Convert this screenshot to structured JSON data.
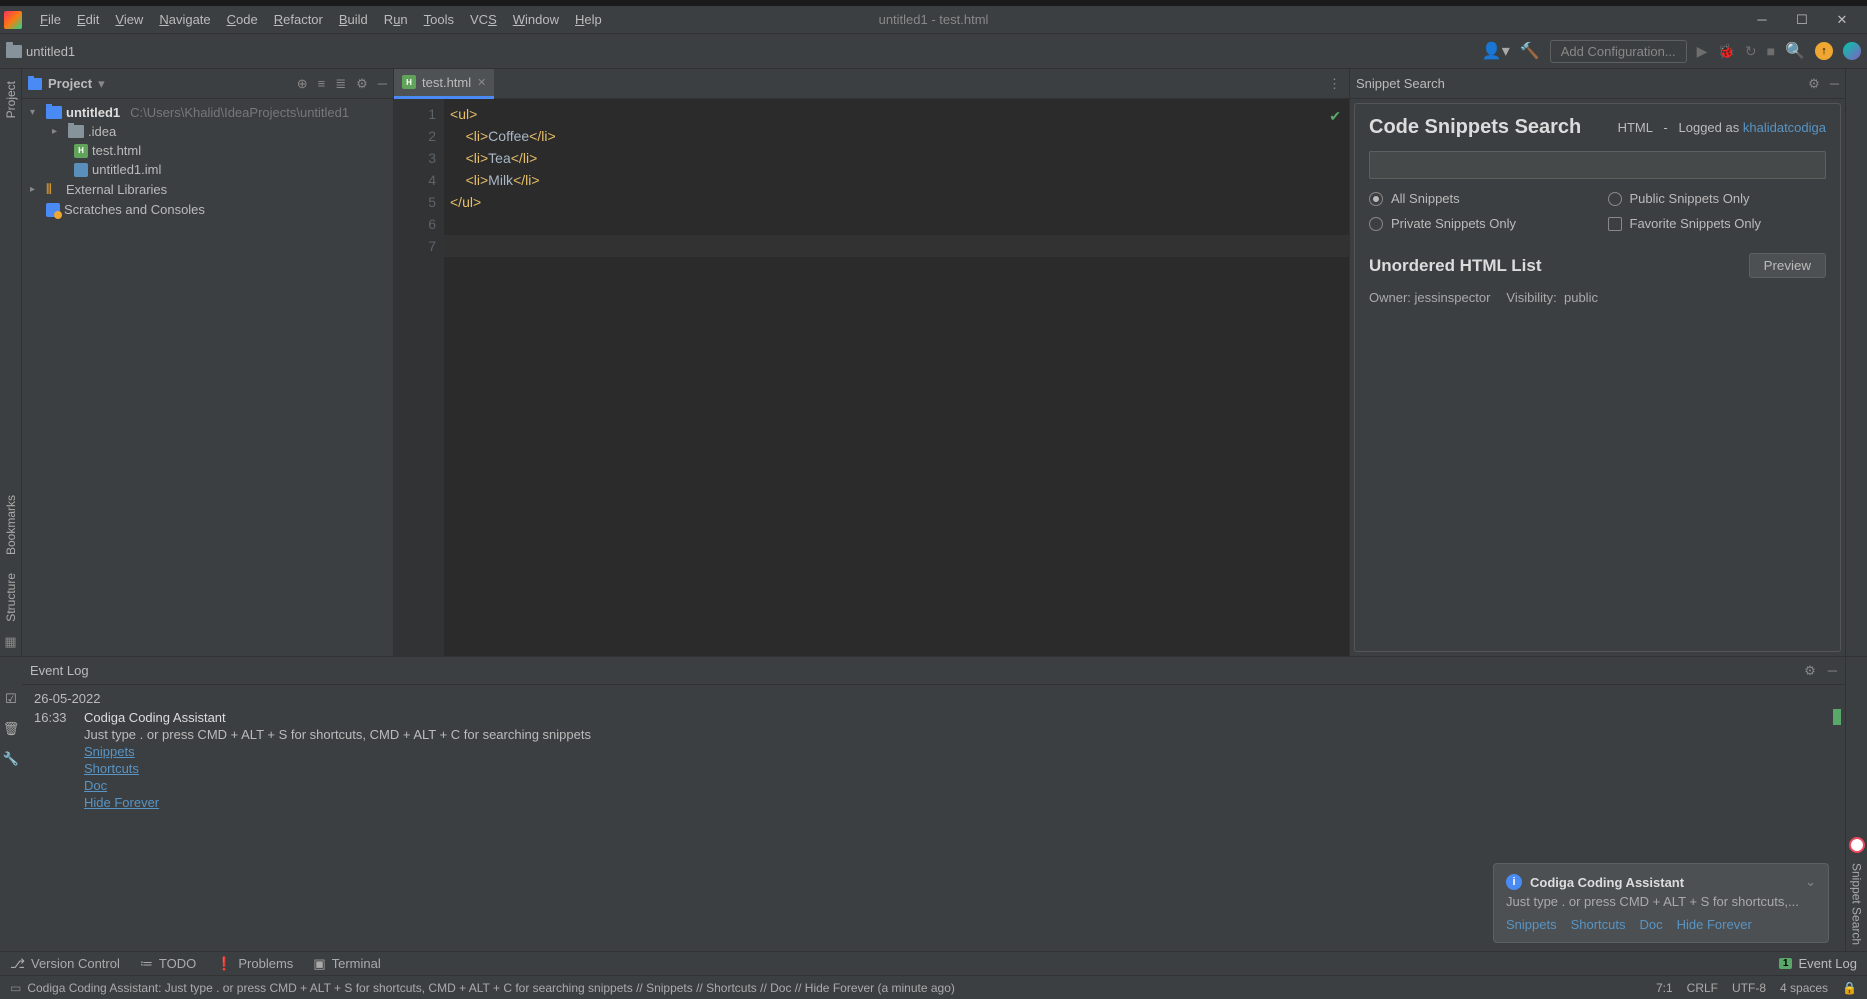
{
  "titlebar": {
    "menu": [
      "File",
      "Edit",
      "View",
      "Navigate",
      "Code",
      "Refactor",
      "Build",
      "Run",
      "Tools",
      "VCS",
      "Window",
      "Help"
    ],
    "center_title": "untitled1 - test.html"
  },
  "navbar": {
    "project_name": "untitled1",
    "add_config": "Add Configuration..."
  },
  "project_panel": {
    "title": "Project",
    "root": {
      "name": "untitled1",
      "path": "C:\\Users\\Khalid\\IdeaProjects\\untitled1"
    },
    "idea_folder": ".idea",
    "file_html": "test.html",
    "file_iml": "untitled1.iml",
    "external_libs": "External Libraries",
    "scratches": "Scratches and Consoles"
  },
  "editor": {
    "tab_name": "test.html",
    "lines": [
      {
        "n": "1",
        "indent": "",
        "open": true,
        "tag": "ul",
        "text": ""
      },
      {
        "n": "2",
        "indent": "    ",
        "open": true,
        "tag": "li",
        "text": "Coffee",
        "close": true
      },
      {
        "n": "3",
        "indent": "    ",
        "open": true,
        "tag": "li",
        "text": "Tea",
        "close": true
      },
      {
        "n": "4",
        "indent": "    ",
        "open": true,
        "tag": "li",
        "text": "Milk",
        "close": true
      },
      {
        "n": "5",
        "indent": "",
        "closing": true,
        "tag": "ul"
      },
      {
        "n": "6"
      },
      {
        "n": "7"
      }
    ]
  },
  "snippet": {
    "panel_title": "Snippet Search",
    "title": "Code Snippets Search",
    "lang": "HTML",
    "sep": "-",
    "logged": "Logged as",
    "user": "khalidatcodiga",
    "filters": {
      "all": "All Snippets",
      "public": "Public Snippets Only",
      "private": "Private Snippets Only",
      "favorite": "Favorite Snippets Only"
    },
    "result_title": "Unordered HTML List",
    "preview": "Preview",
    "owner_label": "Owner:",
    "owner": "jessinspector",
    "visibility_label": "Visibility:",
    "visibility": "public"
  },
  "event_log": {
    "title": "Event Log",
    "date": "26-05-2022",
    "time": "16:33",
    "entry_title": "Codiga Coding Assistant",
    "entry_text": "Just type . or press CMD + ALT + S for shortcuts, CMD + ALT + C for searching snippets",
    "links": [
      "Snippets",
      "Shortcuts",
      "Doc",
      "Hide Forever"
    ]
  },
  "notif": {
    "title": "Codiga Coding Assistant",
    "text": "Just type . or press CMD + ALT + S for shortcuts,...",
    "links": [
      "Snippets",
      "Shortcuts",
      "Doc",
      "Hide Forever"
    ]
  },
  "left_rail": {
    "project": "Project",
    "bookmarks": "Bookmarks",
    "structure": "Structure"
  },
  "right_rail": {
    "snippet_search": "Snippet Search"
  },
  "tool_strip": {
    "version_control": "Version Control",
    "todo": "TODO",
    "problems": "Problems",
    "terminal": "Terminal",
    "event_log": "Event Log"
  },
  "status": {
    "message": "Codiga Coding Assistant: Just type . or press CMD + ALT + S for shortcuts, CMD + ALT + C for searching snippets // Snippets // Shortcuts // Doc // Hide Forever (a minute ago)",
    "pos": "7:1",
    "eol": "CRLF",
    "enc": "UTF-8",
    "indent": "4 spaces"
  }
}
